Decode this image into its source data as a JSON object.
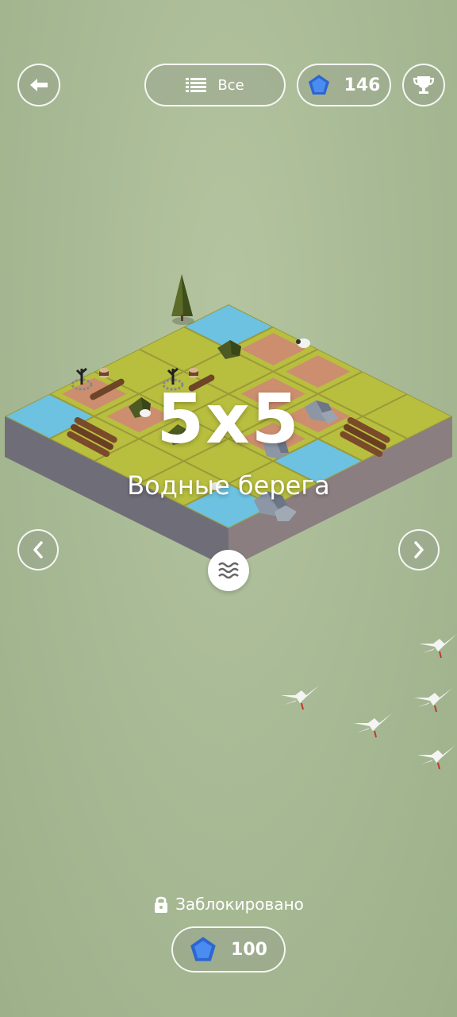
{
  "header": {
    "filter_label": "Все",
    "gems_count": "146"
  },
  "level": {
    "size_label": "5x5",
    "name": "Водные берега"
  },
  "unlock": {
    "status": "Заблокировано",
    "price": "100"
  },
  "colors": {
    "grass": "#b8be3e",
    "water": "#6cc2e0",
    "sand": "#cc8e6e",
    "gem": "#3b7be0"
  },
  "icons": [
    "back-arrow-icon",
    "list-icon",
    "gem-icon",
    "trophy-icon",
    "chevron-left-icon",
    "chevron-right-icon",
    "waves-icon",
    "lock-icon"
  ]
}
